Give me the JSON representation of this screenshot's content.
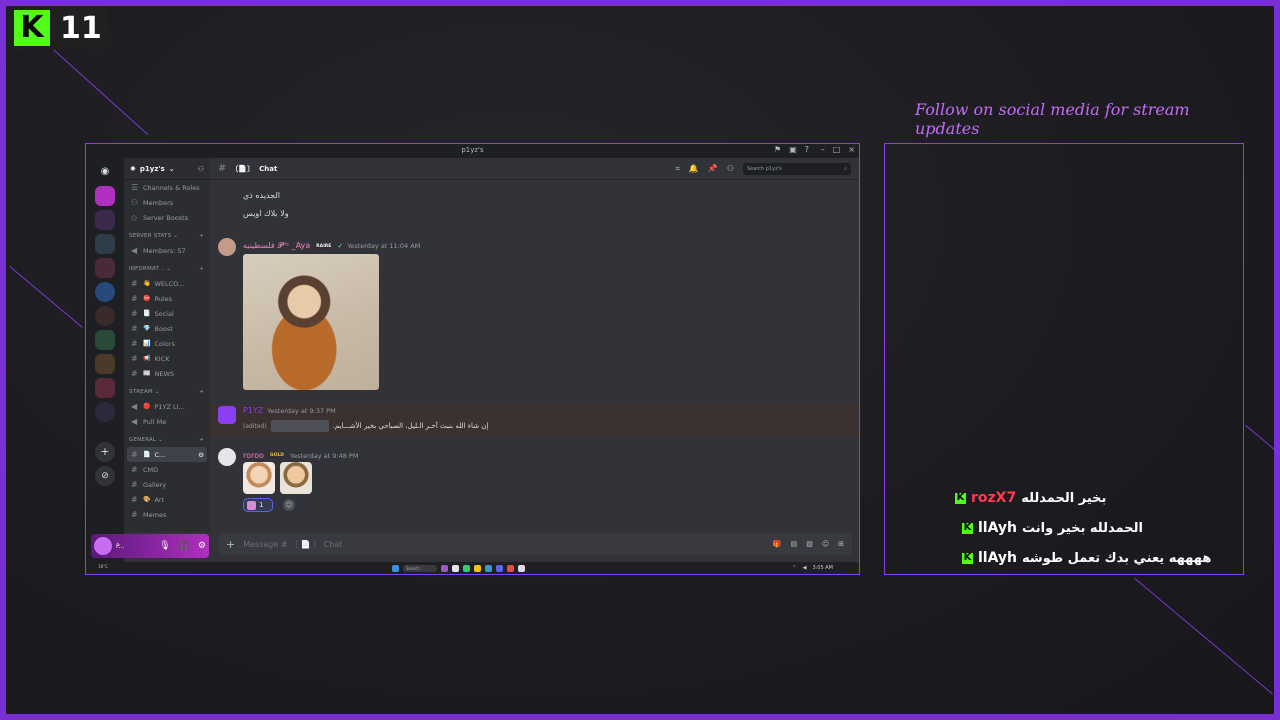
{
  "overlay": {
    "logo_letter": "K",
    "counter": "11",
    "follow_text": "Follow on social media for stream updates",
    "accent_color": "#8a3ff0",
    "kick_green": "#53fc18"
  },
  "window": {
    "title": "p1yz's"
  },
  "sidebar": {
    "guild_name": "p1yz's",
    "items": [
      {
        "label": "Channels & Roles",
        "icon": "channels-icon"
      },
      {
        "label": "Members",
        "icon": "members-icon"
      },
      {
        "label": "Server Boosts",
        "icon": "boost-icon"
      }
    ],
    "categories": [
      {
        "label": "SERVER STATS ⌄",
        "channels": [
          {
            "name": "Members: 57",
            "type": "voice"
          }
        ]
      },
      {
        "label": "INFORMAT... ⌄",
        "channels": [
          {
            "name": "WELCO...",
            "emoji": "👋"
          },
          {
            "name": "Rules",
            "emoji": "⛔"
          },
          {
            "name": "Social",
            "emoji": "📑"
          },
          {
            "name": "Boost",
            "emoji": "💎"
          },
          {
            "name": "Colors",
            "emoji": "📊"
          },
          {
            "name": "KICK",
            "emoji": "📢"
          },
          {
            "name": "NEWS",
            "emoji": "📰"
          }
        ]
      },
      {
        "label": "STREAM ⌄",
        "channels": [
          {
            "name": "P1YZ LI...",
            "emoji": "🔴",
            "type": "voice"
          },
          {
            "name": "Pull Me",
            "type": "voice"
          }
        ]
      },
      {
        "label": "GENERAL ⌄",
        "channels": [
          {
            "name": "C...",
            "emoji": "📄",
            "active": true
          },
          {
            "name": "CMD",
            "emoji": ""
          },
          {
            "name": "Gallery",
            "emoji": ""
          },
          {
            "name": "Art",
            "emoji": "🎨"
          },
          {
            "name": "Memes",
            "emoji": ""
          }
        ]
      }
    ]
  },
  "user_panel": {
    "name": "P..."
  },
  "channel": {
    "name": "Chat",
    "search_placeholder": "Search p1yz's"
  },
  "messages": {
    "top_lines": [
      "الجديده ذي",
      "ولا بلاك اويس"
    ],
    "aya": {
      "name": "فلسطينيه 𝓟ᴾˢ _Aya",
      "tag": "RAIRE",
      "time": "Yesterday at 11:04 AM"
    },
    "p1yz": {
      "name": "P1YZ",
      "time": "Yesterday at 9:37 PM",
      "edited": "(edited)",
      "text": "إن شاء الله بنبث آخـر الـليل، الصباحي بخير الأشـــايم."
    },
    "roroo": {
      "name": "roroo",
      "tag": "GOLD",
      "time": "Yesterday at 9:48 PM",
      "reaction_count": "1"
    }
  },
  "composer": {
    "placeholder": "Message # 〔 📄 〕 Chat"
  },
  "taskbar": {
    "search": "Search",
    "left_text": "18°C",
    "time": "3:05 AM"
  },
  "chat": [
    {
      "user": "rozX7",
      "user_color": "#ff3b4e",
      "text": "بخير الحمدلله"
    },
    {
      "user": "llAyh",
      "user_color": "#ffffff",
      "text": "الحمدلله بخير وانت"
    },
    {
      "user": "llAyh",
      "user_color": "#ffffff",
      "text": "ههههه يعني بدك تعمل طوشه"
    }
  ]
}
